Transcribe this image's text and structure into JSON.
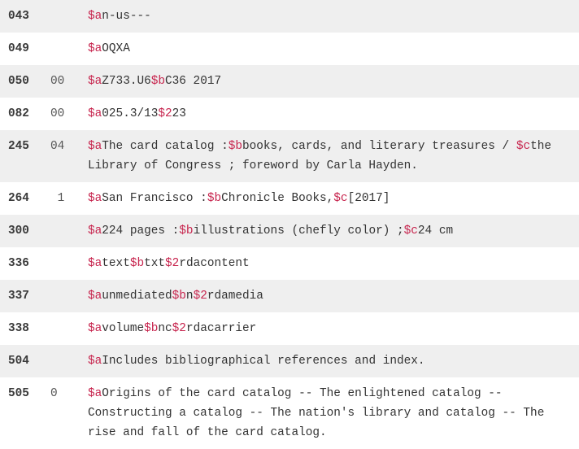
{
  "colors": {
    "subfield": "#c7254e",
    "text": "#333333",
    "shaded_row": "#efefef"
  },
  "fields": [
    {
      "tag": "043",
      "ind": "",
      "subfields": [
        {
          "code": "$a",
          "text": "n-us---"
        }
      ]
    },
    {
      "tag": "049",
      "ind": "",
      "subfields": [
        {
          "code": "$a",
          "text": "OQXA"
        }
      ]
    },
    {
      "tag": "050",
      "ind": "00",
      "subfields": [
        {
          "code": "$a",
          "text": "Z733.U6"
        },
        {
          "code": "$b",
          "text": "C36 2017"
        }
      ]
    },
    {
      "tag": "082",
      "ind": "00",
      "subfields": [
        {
          "code": "$a",
          "text": "025.3/13"
        },
        {
          "code": "$2",
          "text": "23"
        }
      ]
    },
    {
      "tag": "245",
      "ind": "04",
      "subfields": [
        {
          "code": "$a",
          "text": "The card catalog :"
        },
        {
          "code": "$b",
          "text": "books, cards, and literary treasures / "
        },
        {
          "code": "$c",
          "text": "the Library of Congress ; foreword by Carla Hayden."
        }
      ]
    },
    {
      "tag": "264",
      "ind": " 1",
      "subfields": [
        {
          "code": "$a",
          "text": "San Francisco :"
        },
        {
          "code": "$b",
          "text": "Chronicle Books,"
        },
        {
          "code": "$c",
          "text": "[2017]"
        }
      ]
    },
    {
      "tag": "300",
      "ind": "",
      "subfields": [
        {
          "code": "$a",
          "text": "224 pages :"
        },
        {
          "code": "$b",
          "text": "illustrations (chefly color) ;"
        },
        {
          "code": "$c",
          "text": "24 cm"
        }
      ]
    },
    {
      "tag": "336",
      "ind": "",
      "subfields": [
        {
          "code": "$a",
          "text": "text"
        },
        {
          "code": "$b",
          "text": "txt"
        },
        {
          "code": "$2",
          "text": "rdacontent"
        }
      ]
    },
    {
      "tag": "337",
      "ind": "",
      "subfields": [
        {
          "code": "$a",
          "text": "unmediated"
        },
        {
          "code": "$b",
          "text": "n"
        },
        {
          "code": "$2",
          "text": "rdamedia"
        }
      ]
    },
    {
      "tag": "338",
      "ind": "",
      "subfields": [
        {
          "code": "$a",
          "text": "volume"
        },
        {
          "code": "$b",
          "text": "nc"
        },
        {
          "code": "$2",
          "text": "rdacarrier"
        }
      ]
    },
    {
      "tag": "504",
      "ind": "",
      "subfields": [
        {
          "code": "$a",
          "text": "Includes bibliographical references and index."
        }
      ]
    },
    {
      "tag": "505",
      "ind": "0",
      "subfields": [
        {
          "code": "$a",
          "text": "Origins of the card catalog -- The enlightened catalog -- Constructing a catalog -- The nation's library and catalog -- The rise and fall of the card catalog."
        }
      ]
    }
  ]
}
